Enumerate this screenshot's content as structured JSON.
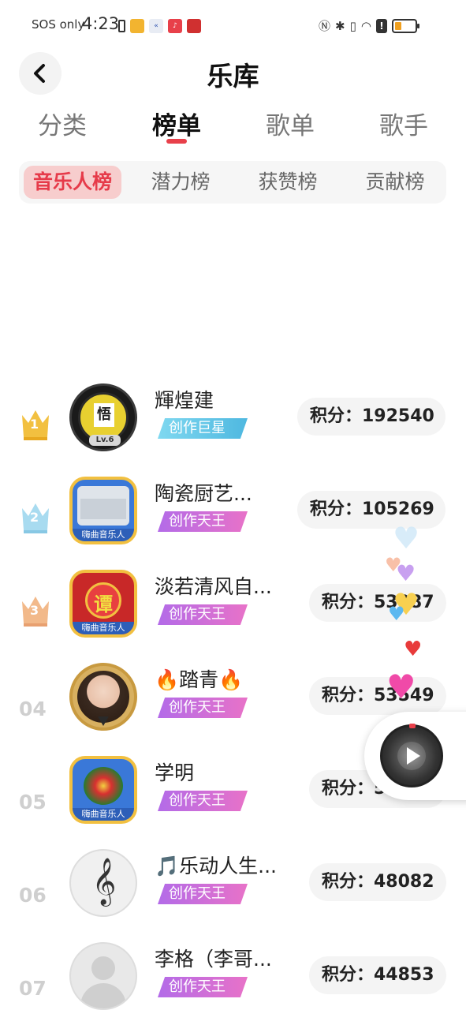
{
  "status_bar": {
    "carrier_text": "SOS only",
    "time": "4:23",
    "notification_icons": [
      "sim-icon",
      "wallet-app-icon",
      "arrow-app-icon",
      "music-app-icon",
      "news-app-icon"
    ],
    "system_icons": [
      "nfc-icon",
      "bluetooth-icon",
      "vibrate-icon",
      "wifi-icon",
      "alert-icon",
      "battery-icon"
    ]
  },
  "header": {
    "title": "乐库",
    "back_icon": "chevron-left-icon"
  },
  "main_tabs": [
    {
      "label": "分类",
      "active": false
    },
    {
      "label": "榜单",
      "active": true
    },
    {
      "label": "歌单",
      "active": false
    },
    {
      "label": "歌手",
      "active": false
    }
  ],
  "sub_tabs": [
    {
      "label": "音乐人榜",
      "active": true
    },
    {
      "label": "潜力榜",
      "active": false
    },
    {
      "label": "获赞榜",
      "active": false
    },
    {
      "label": "贡献榜",
      "active": false
    }
  ],
  "ranking": [
    {
      "rank": "1",
      "rank_type": "gold-crown",
      "name": "輝煌建",
      "badge": "创作巨星",
      "badge_style": "blue",
      "score": "积分：192540"
    },
    {
      "rank": "2",
      "rank_type": "silver-crown",
      "name": "陶瓷厨艺...",
      "badge": "创作天王",
      "badge_style": "purple",
      "score": "积分：105269"
    },
    {
      "rank": "3",
      "rank_type": "bronze-crown",
      "name": "淡若清风自...",
      "badge": "创作天王",
      "badge_style": "purple",
      "score": "积分：53087"
    },
    {
      "rank": "04",
      "rank_type": "number",
      "name": "🔥踏青🔥",
      "badge": "创作天王",
      "badge_style": "purple",
      "score": "积分：53549"
    },
    {
      "rank": "05",
      "rank_type": "number",
      "name": "学明",
      "badge": "创作天王",
      "badge_style": "purple",
      "score": "积分：5"
    },
    {
      "rank": "06",
      "rank_type": "number",
      "name": "🎵乐动人生...",
      "badge": "创作天王",
      "badge_style": "purple",
      "score": "积分：48082"
    },
    {
      "rank": "07",
      "rank_type": "number",
      "name": "李格（李哥...",
      "badge": "创作天王",
      "badge_style": "purple",
      "score": "积分：44853"
    }
  ],
  "avatar_texts": {
    "level": "Lv.6",
    "music_label": "嗨曲音乐人",
    "char_1": "悟",
    "char_3": "谭"
  },
  "floating_player": {
    "icon": "play-icon"
  },
  "colors": {
    "accent_red": "#e8404a",
    "subtab_active_bg": "#f7cdcd",
    "badge_blue": "#5cc8e8",
    "badge_purple": "#b36be8",
    "gold": "#f2c040",
    "silver": "#a8dbf0",
    "bronze": "#f2b98a"
  }
}
